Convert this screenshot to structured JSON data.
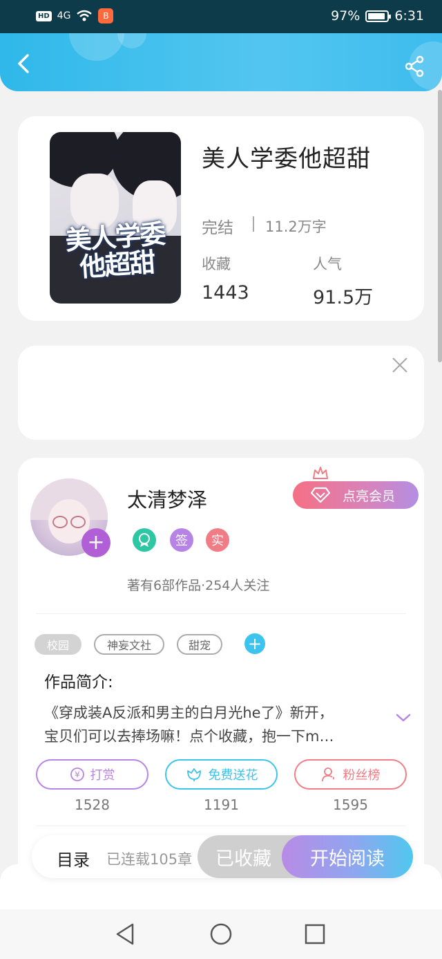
{
  "status_bar": {
    "hd": "HD",
    "signal": "4G",
    "app_badge": "B",
    "battery": "97%",
    "time": "6:31"
  },
  "header": {
    "back_icon": "back-arrow-icon",
    "share_icon": "share-icon"
  },
  "book": {
    "title": "美人学委他超甜",
    "cover_title": "美人学委 他超甜",
    "status": "完结",
    "word_count": "11.2万字",
    "stats": [
      {
        "label": "收藏",
        "value": "1443"
      },
      {
        "label": "人气",
        "value": "91.5万"
      }
    ]
  },
  "ad": {
    "close_icon": "close-icon"
  },
  "author": {
    "name": "太清梦泽",
    "follow_symbol": "+",
    "badges": [
      {
        "icon": "medal-icon",
        "text": "",
        "color": "#2ec7a4"
      },
      {
        "icon": "signed-badge",
        "text": "签",
        "color": "#b883e6"
      },
      {
        "icon": "verified-badge",
        "text": "实",
        "color": "#f07d85"
      }
    ],
    "stats_text": "著有6部作品·254人关注",
    "vip_label": "点亮会员"
  },
  "tags": [
    {
      "text": "校园",
      "style": "solid"
    },
    {
      "text": "神妄文社",
      "style": "outline"
    },
    {
      "text": "甜宠",
      "style": "outline"
    }
  ],
  "tag_add_symbol": "+",
  "intro": {
    "label": "作品简介:",
    "line1": "《穿成装A反派和男主的白月光he了》新开，",
    "line2": "宝贝们可以去捧场嘛！点个收藏，抱一下m…"
  },
  "actions": [
    {
      "label": "打赏",
      "count": "1528",
      "color": "#b883e6",
      "icon": "yen-icon"
    },
    {
      "label": "免费送花",
      "count": "1191",
      "color": "#3cc3ee",
      "icon": "flower-icon"
    },
    {
      "label": "粉丝榜",
      "count": "1595",
      "color": "#f07d85",
      "icon": "fans-icon"
    }
  ],
  "bottom": {
    "toc_label": "目录",
    "serial_text": "已连载105章",
    "collected_label": "已收藏",
    "read_label": "开始阅读"
  },
  "nav": {
    "back": "triangle-back-icon",
    "home": "circle-home-icon",
    "recents": "square-recents-icon"
  }
}
